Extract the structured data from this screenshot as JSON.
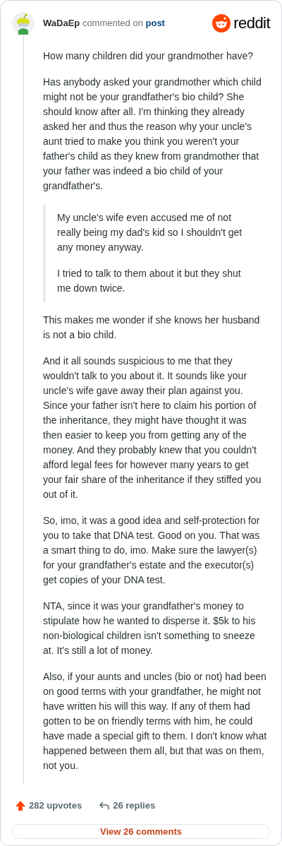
{
  "header": {
    "author": "WaDaEp",
    "action": "commented on",
    "link": "post",
    "brand": "reddit"
  },
  "body": [
    {
      "kind": "paragraph",
      "text": "How many children did your grandmother have?"
    },
    {
      "kind": "paragraph",
      "text": "Has anybody asked your grandmother which child might not be your grandfather's bio child? She should know after all. I'm thinking they already asked her and thus the reason why your uncle's aunt tried to make you think you weren't your father's child as they knew from grandmother that your father was indeed a bio child of your grandfather's."
    },
    {
      "kind": "quote",
      "paragraphs": [
        "My uncle's wife even accused me of not really being my dad's kid so I shouldn't get any money anyway.",
        "I tried to talk to them about it but they shut me down twice."
      ]
    },
    {
      "kind": "paragraph",
      "text": "This makes me wonder if she knows her husband is not a bio child."
    },
    {
      "kind": "paragraph",
      "text": "And it all sounds suspicious to me that they wouldn't talk to you about it. It sounds like your uncle's wife gave away their plan against you. Since your father isn't here to claim his portion of the inheritance, they might have thought it was then easier to keep you from getting any of the money. And they probably knew that you couldn't afford legal fees for however many years to get your fair share of the inheritance if they stiffed you out of it."
    },
    {
      "kind": "paragraph",
      "text": "So, imo, it was a good idea and self-protection for you to take that DNA test. Good on you. That was a smart thing to do, imo. Make sure the lawyer(s) for your grandfather's estate and the executor(s) get copies of your DNA test."
    },
    {
      "kind": "paragraph",
      "text": "NTA, since it was your grandfather's money to stipulate how he wanted to disperse it. $5k to his non-biological children isn't something to sneeze at. It's still a lot of money."
    },
    {
      "kind": "paragraph",
      "text": "Also, if your aunts and uncles (bio or not) had been on good terms with your grandfather, he might not have written his will this way. If any of them had gotten to be on friendly terms with him, he could have made a special gift to them. I don't know what happened between them all, but that was on them, not you."
    }
  ],
  "footer": {
    "upvotes": "282 upvotes",
    "replies": "26 replies",
    "view_button": "View 26 comments"
  }
}
